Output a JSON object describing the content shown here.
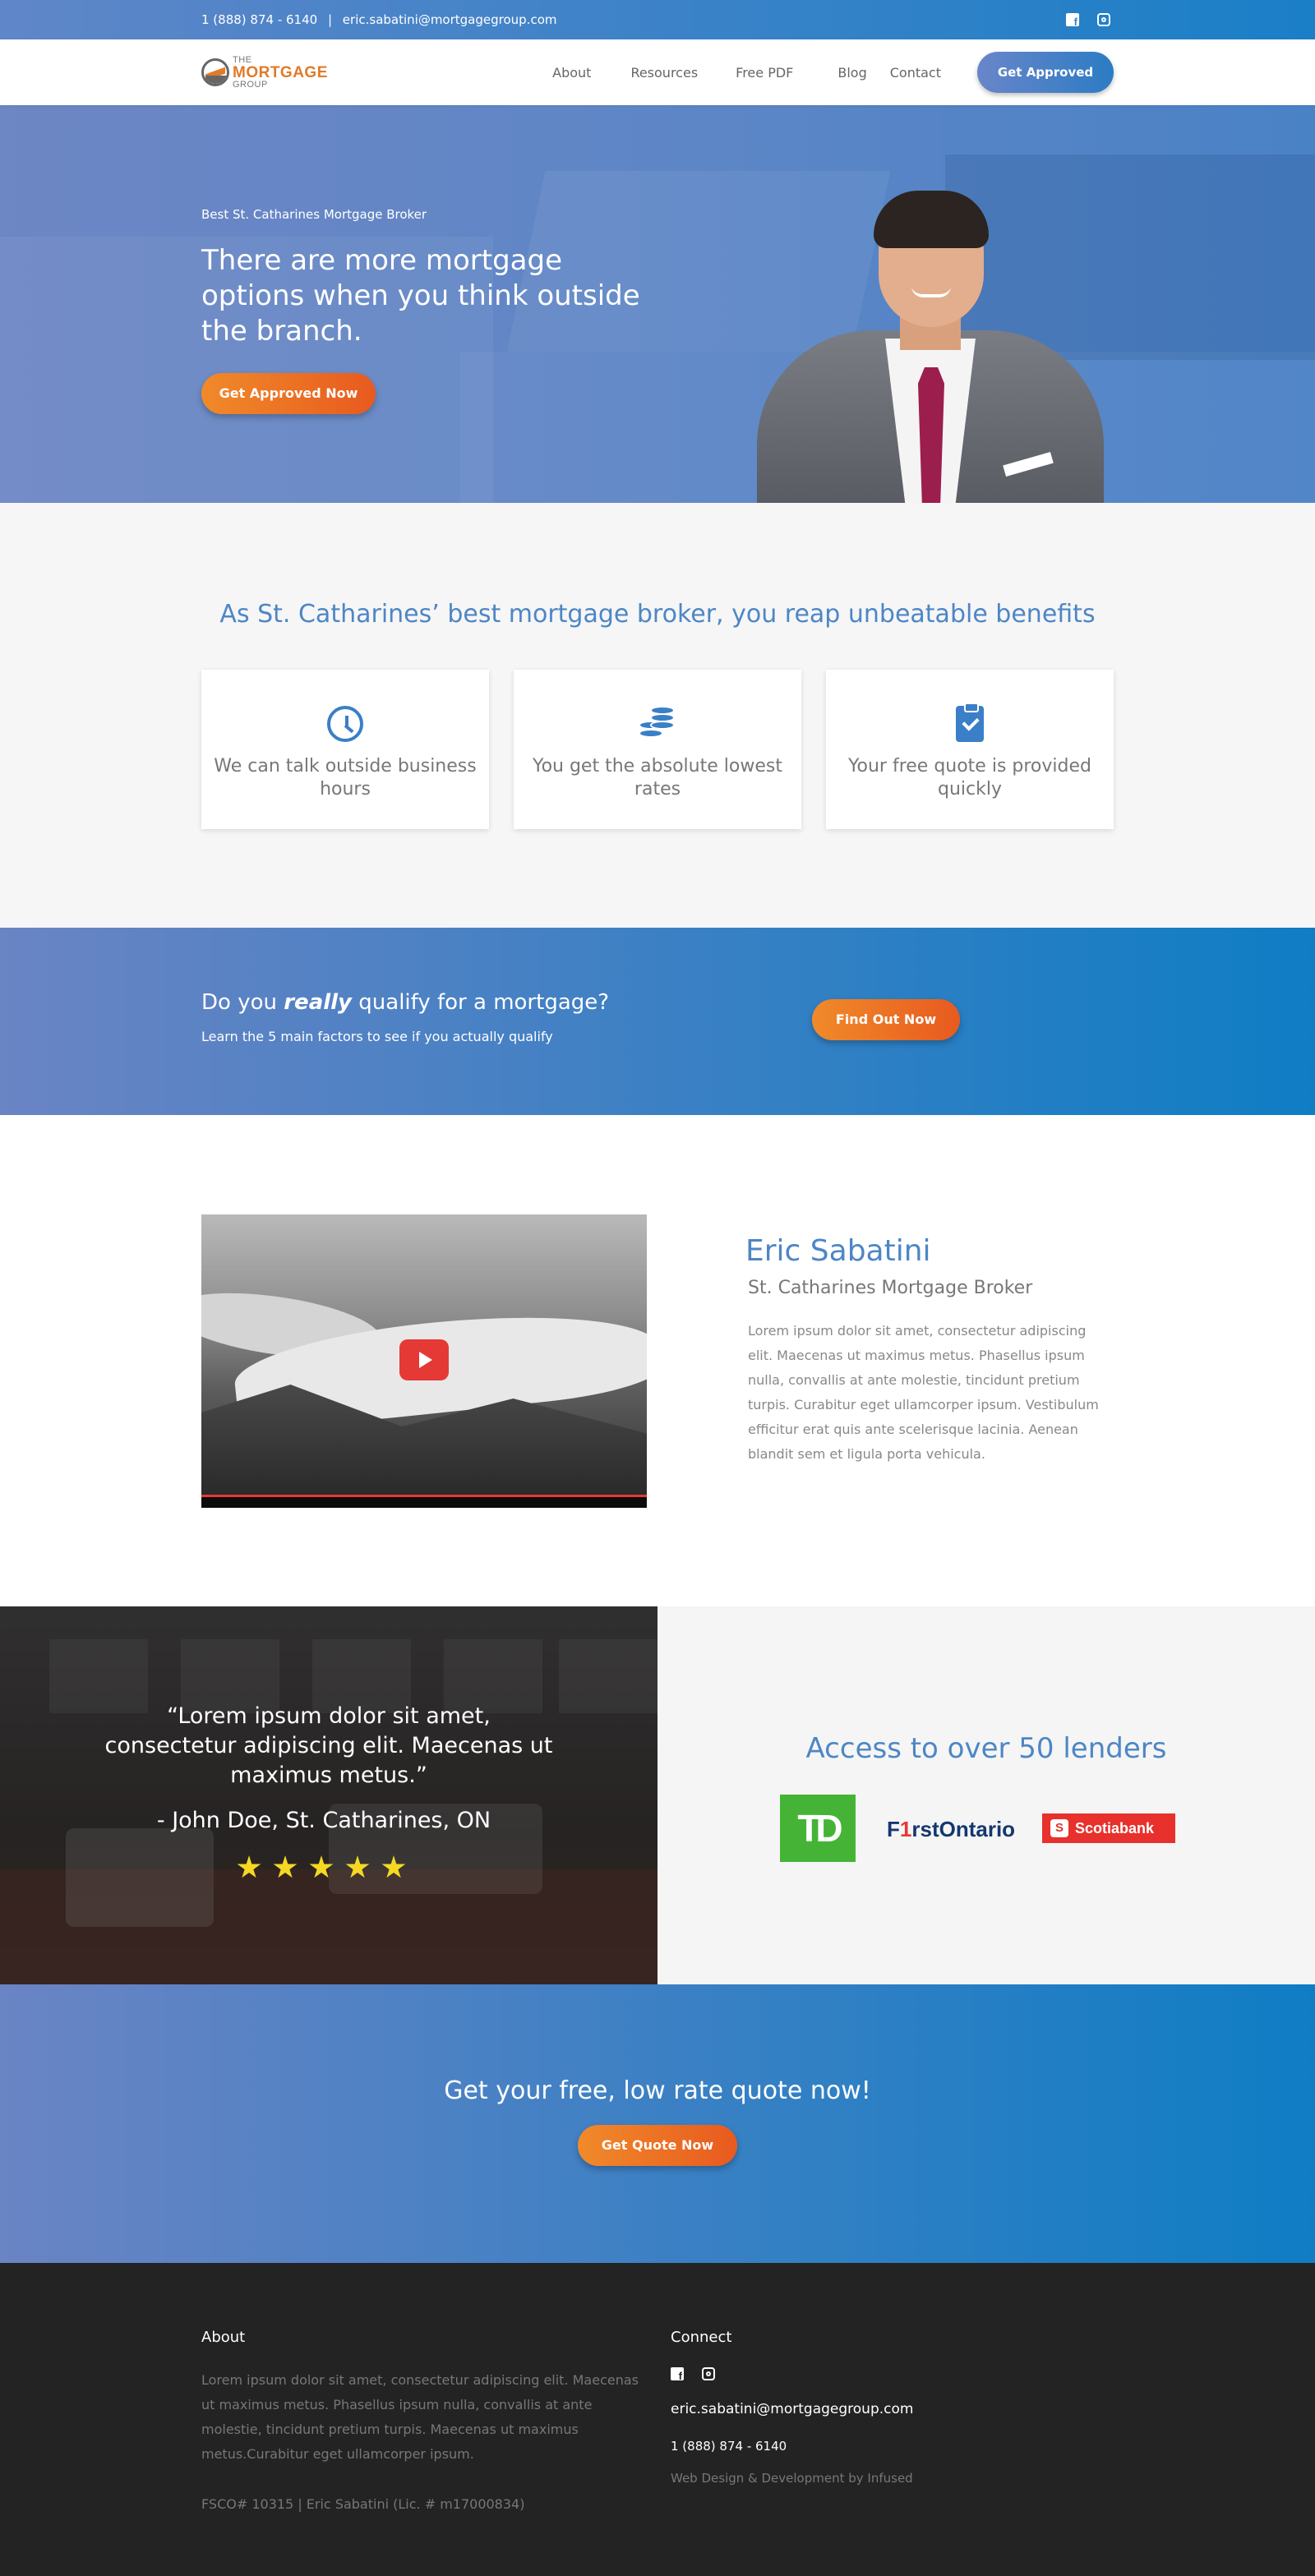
{
  "topbar": {
    "phone": "1 (888) 874 - 6140",
    "separator": "|",
    "email": "eric.sabatini@mortgagegroup.com",
    "icons": [
      "facebook-icon",
      "instagram-icon"
    ]
  },
  "nav": {
    "logo": {
      "line1": "THE",
      "line2": "MORTGAGE",
      "line3": "GROUP"
    },
    "items": [
      "About",
      "Resources",
      "Free PDF",
      "Blog",
      "Contact"
    ],
    "cta": "Get Approved"
  },
  "hero": {
    "eyebrow": "Best St. Catharines Mortgage Broker",
    "title": "There are more mortgage options when you think outside the branch.",
    "cta": "Get Approved Now"
  },
  "benefits": {
    "heading": "As St. Catharines’ best mortgage broker, you reap unbeatable benefits",
    "cards": [
      {
        "icon": "clock-icon",
        "text": "We can talk outside business hours"
      },
      {
        "icon": "coins-icon",
        "text": "You get the absolute lowest rates"
      },
      {
        "icon": "clipboard-check-icon",
        "text": "Your free quote is provided quickly"
      }
    ]
  },
  "qualify": {
    "title_pre": "Do you ",
    "title_em": "really",
    "title_post": " qualify for a mortgage?",
    "subtitle": "Learn the 5 main factors to see if you actually qualify",
    "cta": "Find Out Now"
  },
  "about": {
    "name": "Eric Sabatini",
    "role": "St. Catharines Mortgage Broker",
    "bio": "Lorem ipsum dolor sit amet, consectetur adipiscing elit. Maecenas ut maximus metus. Phasellus ipsum nulla, convallis at ante molestie, tincidunt pretium turpis. Curabitur eget ullamcorper ipsum. Vestibulum efficitur erat quis ante scelerisque lacinia. Aenean blandit sem et ligula porta vehicula."
  },
  "testimonial": {
    "quote": "“Lorem ipsum dolor sit amet, consectetur adipiscing elit. Maecenas ut maximus metus.”",
    "author": "- John Doe, St. Catharines, ON",
    "rating": 5
  },
  "lenders": {
    "heading": "Access to over 50 lenders",
    "logos": {
      "td": "TD",
      "firstontario_pre": "F",
      "firstontario_one": "1",
      "firstontario_post": "rstOntario",
      "scotiabank": "Scotiabank"
    }
  },
  "cta": {
    "heading": "Get your free, low rate quote now!",
    "button": "Get Quote Now"
  },
  "footer": {
    "about_title": "About",
    "about_text": "Lorem ipsum dolor sit amet, consectetur adipiscing elit. Maecenas ut maximus metus. Phasellus ipsum nulla, convallis at ante molestie, tincidunt pretium turpis. Maecenas ut maximus metus.Curabitur eget ullamcorper ipsum.",
    "license": "FSCO# 10315 | Eric Sabatini (Lic. # m17000834)",
    "connect_title": "Connect",
    "email": "eric.sabatini@mortgagegroup.com",
    "phone": "1 (888) 874 - 6140",
    "credit": "Web Design & Development by Infused"
  },
  "colors": {
    "brand_blue": "#4d86c5",
    "gradient_start": "#6a84c4",
    "gradient_end": "#0f7dc4",
    "orange": "#e85a1f",
    "footer_bg": "#232323"
  }
}
